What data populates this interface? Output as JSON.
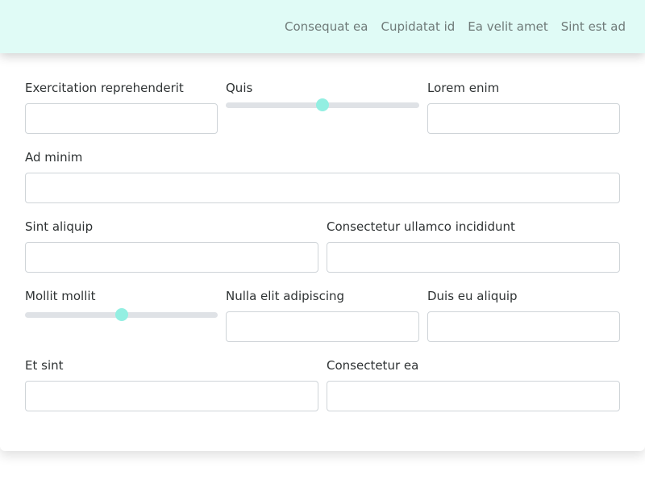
{
  "nav": {
    "links": [
      "Consequat ea",
      "Cupidatat id",
      "Ea velit amet",
      "Sint est ad"
    ]
  },
  "form": {
    "row1": {
      "field1_label": "Exercitation reprehenderit",
      "field2_label": "Quis",
      "field2_value": 0.5,
      "field3_label": "Lorem enim"
    },
    "row2": {
      "field1_label": "Ad minim"
    },
    "row3": {
      "field1_label": "Sint aliquip",
      "field2_label": "Consectetur ullamco incididunt"
    },
    "row4": {
      "field1_label": "Mollit mollit",
      "field1_value": 0.5,
      "field2_label": "Nulla elit adipiscing",
      "field3_label": "Duis eu aliquip"
    },
    "row5": {
      "field1_label": "Et sint",
      "field2_label": "Consectetur ea"
    }
  },
  "colors": {
    "header_bg": "#e0fbf6",
    "slider_thumb": "#93efe2",
    "slider_track": "#dfe2e6"
  }
}
